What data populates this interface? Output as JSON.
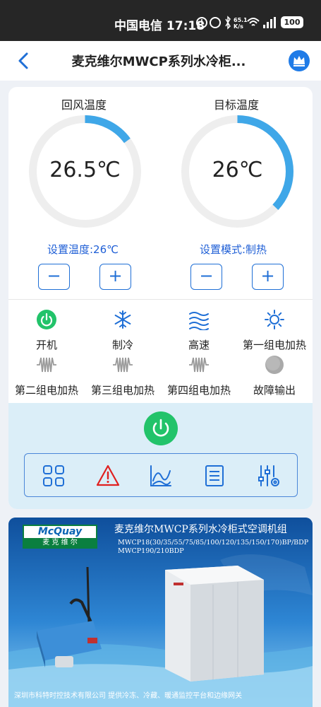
{
  "statusbar": {
    "time": "中国电信 17:18",
    "net_speed": "65.1 K/s",
    "battery": "100"
  },
  "navbar": {
    "title": "麦克维尔MWCP系列水冷柜..."
  },
  "gauges": [
    {
      "title": "回风温度",
      "value": "26.5℃",
      "fraction": 0.15
    },
    {
      "title": "目标温度",
      "value": "26℃",
      "fraction": 0.37
    }
  ],
  "setpoints": {
    "set_temp_label": "设置温度:26℃",
    "set_mode_label": "设置模式:制热"
  },
  "controls": {
    "minus": "−",
    "plus": "+"
  },
  "status_items": [
    {
      "label": "开机",
      "icon": "power-on-icon"
    },
    {
      "label": "制冷",
      "icon": "snowflake-icon"
    },
    {
      "label": "高速",
      "icon": "wind-waves-icon"
    },
    {
      "label": "第一组电加热",
      "icon": "sun-icon"
    },
    {
      "label": "第二组电加热",
      "icon": "heater-coil-icon"
    },
    {
      "label": "第三组电加热",
      "icon": "heater-coil-icon"
    },
    {
      "label": "第四组电加热",
      "icon": "heater-coil-icon"
    },
    {
      "label": "故障输出",
      "icon": "fault-dot-icon"
    }
  ],
  "toolbar": [
    {
      "icon": "grid-icon"
    },
    {
      "icon": "alarm-warning-icon"
    },
    {
      "icon": "trend-chart-icon"
    },
    {
      "icon": "list-icon"
    },
    {
      "icon": "settings-sliders-icon"
    }
  ],
  "banner": {
    "logo_en": "McQuay",
    "logo_cn": "麦 克 维 尔",
    "title": "麦克维尔MWCP系列水冷柜式空调机组",
    "models": "MWCP18(30/35/55/75/85/100/120/135/150/170)BP/BDP MWCP190/210BDP",
    "footer": "深圳市科特时控技术有限公司    提供冷冻、冷藏、暖通监控平台和边缘网关"
  },
  "colors": {
    "accent": "#1f6fd6",
    "gauge_arc": "#3fa7e8",
    "power_green": "#22c36a",
    "alarm_red": "#e02020"
  }
}
